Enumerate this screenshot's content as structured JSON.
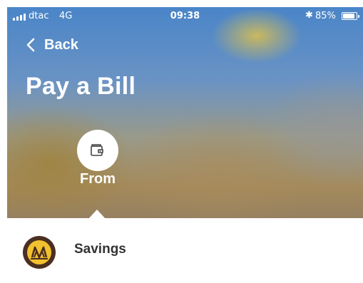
{
  "status_bar": {
    "carrier": "dtac",
    "network": "4G",
    "time": "09:38",
    "bluetooth_icon": "bluetooth-icon",
    "battery_percent": "85%"
  },
  "header": {
    "back_label": "Back",
    "title": "Pay a Bill"
  },
  "steps": {
    "from_label": "From",
    "from_icon": "wallet-icon"
  },
  "account": {
    "name": "Savings",
    "logo_icon": "bank-logo-icon",
    "logo_colors": {
      "ring": "#4b2f20",
      "mark": "#f2c12e"
    }
  }
}
